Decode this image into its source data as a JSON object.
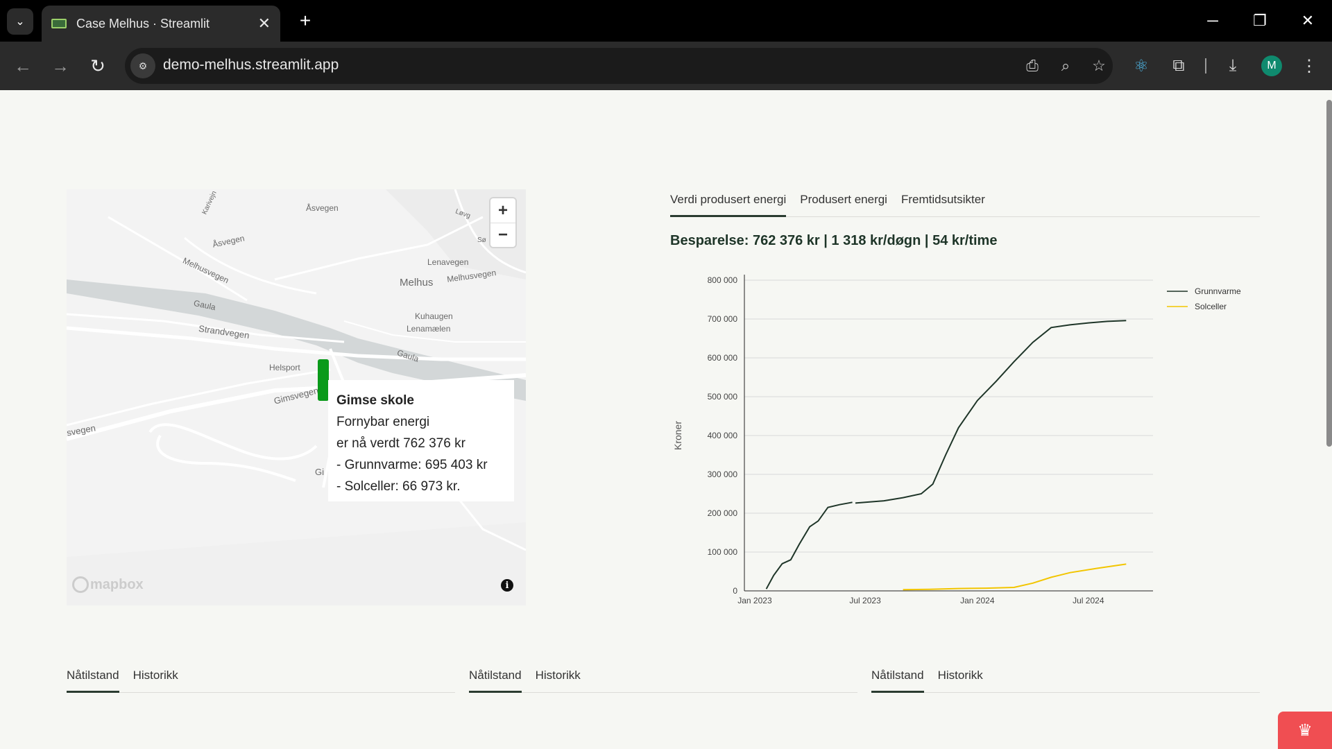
{
  "browser": {
    "tab_title": "Case Melhus · Streamlit",
    "url": "demo-melhus.streamlit.app",
    "profile_initial": "M"
  },
  "map": {
    "labels": [
      "Åsvegen",
      "Åsvegen",
      "Melhusvegen",
      "Lenavegen",
      "Melhus",
      "Melhusvegen",
      "Gaula",
      "Strandvegen",
      "Kuhaugen",
      "Lenamælen",
      "Gaula",
      "Helsport",
      "Gimsvegen",
      "svegen",
      "Gi",
      "Karivejn",
      "Løvg",
      "Sø"
    ],
    "attribution": "mapbox",
    "tooltip": {
      "title": "Gimse skole",
      "line1": "Fornybar energi",
      "line2": "er nå verdt 762 376 kr",
      "line3": "- Grunnvarme: 695 403 kr",
      "line4": "- Solceller: 66 973 kr."
    }
  },
  "panel": {
    "tabs": [
      "Verdi produsert energi",
      "Produsert energi",
      "Fremtidsutsikter"
    ],
    "active_tab": 0,
    "savings_text": "Besparelse: 762 376 kr | 1 318 kr/døgn | 54 kr/time"
  },
  "bottom_tabs": [
    {
      "tabs": [
        "Nåtilstand",
        "Historikk"
      ]
    },
    {
      "tabs": [
        "Nåtilstand",
        "Historikk"
      ]
    },
    {
      "tabs": [
        "Nåtilstand",
        "Historikk"
      ]
    }
  ],
  "colors": {
    "grunnvarme": "#1e3528",
    "solceller": "#f2c500",
    "accent": "#2a3b30",
    "marker": "#0a9a1a"
  },
  "chart_data": {
    "type": "line",
    "xlabel": "",
    "ylabel": "Kroner",
    "x_ticks": [
      "Jan 2023",
      "Jul 2023",
      "Jan 2024",
      "Jul 2024"
    ],
    "y_ticks": [
      "0",
      "100 000",
      "200 000",
      "300 000",
      "400 000",
      "500 000",
      "600 000",
      "700 000",
      "800 000"
    ],
    "ylim": [
      0,
      800000
    ],
    "xlim": [
      "2022-12-15",
      "2024-10-15"
    ],
    "legend_position": "top-right",
    "grid": true,
    "series": [
      {
        "name": "Grunnvarme",
        "segments": [
          [
            [
              "2023-01-20",
              5000
            ],
            [
              "2023-02-01",
              40000
            ],
            [
              "2023-02-15",
              70000
            ],
            [
              "2023-03-01",
              80000
            ],
            [
              "2023-03-15",
              120000
            ],
            [
              "2023-04-01",
              165000
            ],
            [
              "2023-04-15",
              180000
            ],
            [
              "2023-05-01",
              215000
            ],
            [
              "2023-05-20",
              222000
            ],
            [
              "2023-06-10",
              228000
            ]
          ],
          [
            [
              "2023-06-15",
              226000
            ],
            [
              "2023-08-01",
              232000
            ],
            [
              "2023-09-01",
              240000
            ],
            [
              "2023-10-01",
              250000
            ],
            [
              "2023-10-20",
              275000
            ],
            [
              "2023-11-10",
              350000
            ],
            [
              "2023-12-01",
              420000
            ],
            [
              "2024-01-01",
              490000
            ],
            [
              "2024-02-01",
              540000
            ],
            [
              "2024-03-01",
              590000
            ],
            [
              "2024-04-01",
              640000
            ],
            [
              "2024-05-01",
              678000
            ],
            [
              "2024-06-01",
              685000
            ],
            [
              "2024-07-01",
              690000
            ],
            [
              "2024-08-01",
              694000
            ],
            [
              "2024-09-01",
              696000
            ]
          ]
        ]
      },
      {
        "name": "Solceller",
        "segments": [
          [
            [
              "2023-09-01",
              3000
            ],
            [
              "2023-10-15",
              4000
            ],
            [
              "2023-12-01",
              6000
            ],
            [
              "2024-01-15",
              7000
            ],
            [
              "2024-03-01",
              9000
            ],
            [
              "2024-04-01",
              20000
            ],
            [
              "2024-05-01",
              35000
            ],
            [
              "2024-06-01",
              47000
            ],
            [
              "2024-07-15",
              58000
            ],
            [
              "2024-09-01",
              69000
            ]
          ]
        ]
      }
    ]
  }
}
